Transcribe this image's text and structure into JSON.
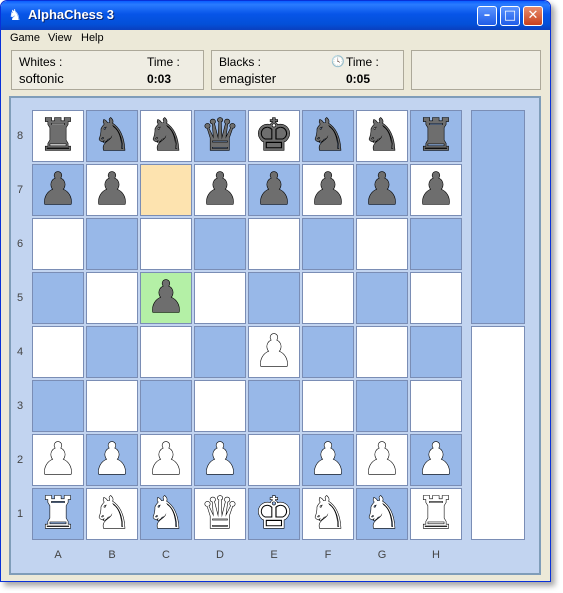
{
  "window": {
    "title": "AlphaChess 3",
    "app_icon": "♞",
    "minimize_glyph": "–",
    "maximize_glyph": "□",
    "close_glyph": "✕"
  },
  "menu": [
    "Game",
    "View",
    "Help"
  ],
  "whites": {
    "label": "Whites :",
    "player": "softonic",
    "time_label": "Time :",
    "time": "0:03"
  },
  "blacks": {
    "label": "Blacks :",
    "player": "emagister",
    "time_label": "Time :",
    "time": "0:05",
    "clock_icon": "🕓"
  },
  "board": {
    "ranks": [
      "8",
      "7",
      "6",
      "5",
      "4",
      "3",
      "2",
      "1"
    ],
    "files": [
      "A",
      "B",
      "C",
      "D",
      "E",
      "F",
      "G",
      "H"
    ],
    "rows": [
      [
        "r",
        "n",
        "n",
        "q",
        "k",
        "n",
        "n",
        "r"
      ],
      [
        "p",
        "p",
        "",
        "p",
        "p",
        "p",
        "p",
        "p"
      ],
      [
        "",
        "",
        "",
        "",
        "",
        "",
        "",
        ""
      ],
      [
        "",
        "",
        "p",
        "",
        "",
        "",
        "",
        ""
      ],
      [
        "",
        "",
        "",
        "",
        "P",
        "",
        "",
        ""
      ],
      [
        "",
        "",
        "",
        "",
        "",
        "",
        "",
        ""
      ],
      [
        "P",
        "P",
        "P",
        "P",
        "",
        "P",
        "P",
        "P"
      ],
      [
        "R",
        "N",
        "N",
        "Q",
        "K",
        "N",
        "N",
        "R"
      ]
    ],
    "last_move_from": "C7",
    "last_move_to": "C5"
  },
  "colors": {
    "light_square": "#FFFFFF",
    "dark_square": "#98B8E8",
    "move_from": "#FDE3AF",
    "move_to": "#B4F0A6",
    "frame": "#C2D4F0"
  }
}
